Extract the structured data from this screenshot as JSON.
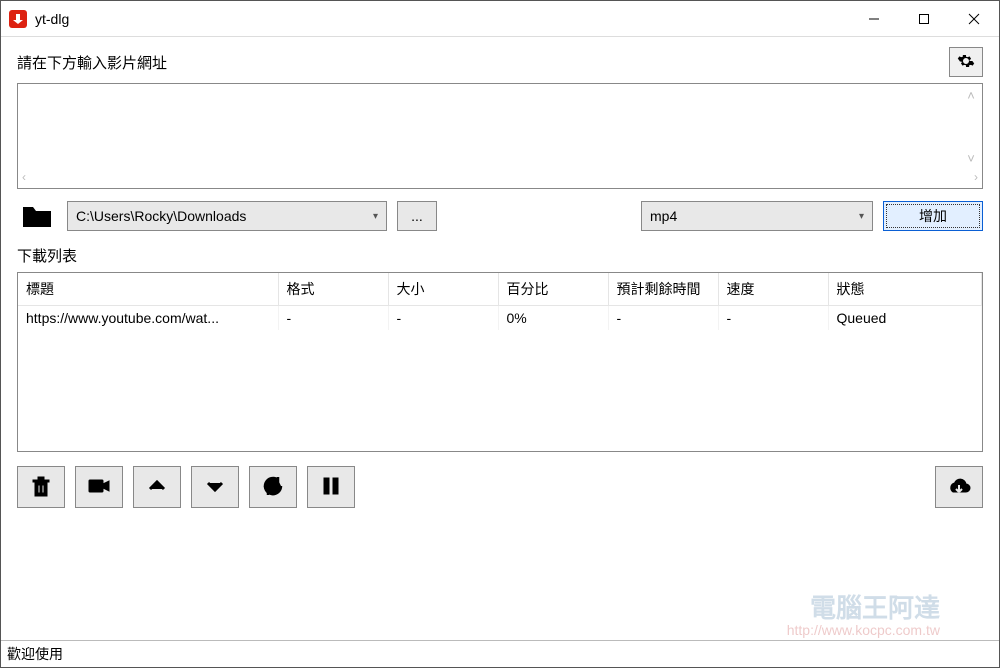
{
  "window": {
    "title": "yt-dlg"
  },
  "instruction_label": "請在下方輸入影片網址",
  "url_input": {
    "value": "",
    "placeholder": ""
  },
  "path": {
    "value": "C:\\Users\\Rocky\\Downloads",
    "browse_label": "..."
  },
  "format": {
    "value": "mp4"
  },
  "add_button_label": "增加",
  "list_label": "下載列表",
  "table": {
    "headers": {
      "title": "標題",
      "ext": "格式",
      "size": "大小",
      "percent": "百分比",
      "eta": "預計剩餘時間",
      "speed": "速度",
      "status": "狀態"
    },
    "rows": [
      {
        "title": "https://www.youtube.com/wat...",
        "ext": "-",
        "size": "-",
        "percent": "0%",
        "eta": "-",
        "speed": "-",
        "status": "Queued"
      }
    ]
  },
  "toolbar": {
    "delete": "delete",
    "video": "video",
    "up": "up",
    "down": "down",
    "reload": "reload",
    "pause": "pause",
    "start": "start"
  },
  "status_text": "歡迎使用",
  "watermark": {
    "text": "電腦王阿達",
    "url": "http://www.kocpc.com.tw"
  }
}
